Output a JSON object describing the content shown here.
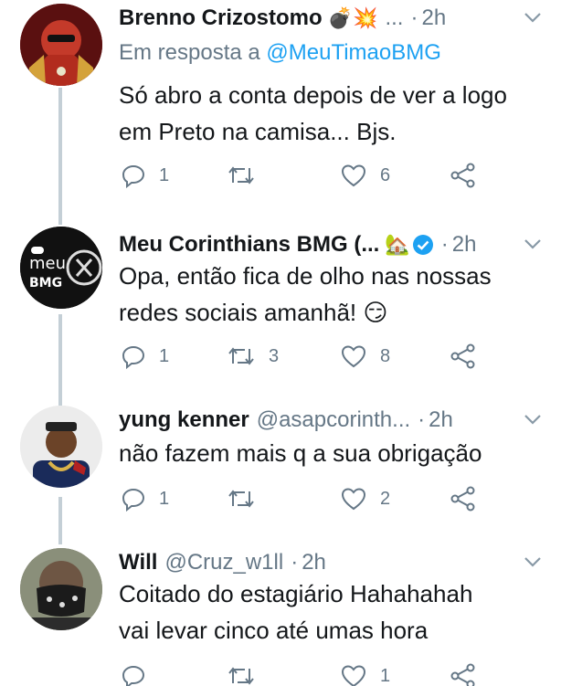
{
  "colors": {
    "secondary_text": "#657786",
    "link": "#1da1f2",
    "verified": "#1da1f2"
  },
  "tweets": [
    {
      "name": "Brenno Crizostomo",
      "name_emoji": "💣💥",
      "ellipsis": "...",
      "time": "2h",
      "reply_prefix": "Em resposta a",
      "reply_mention": "@MeuTimaoBMG",
      "text_line1": "Só abro a conta depois de ver a logo",
      "text_line2": "em Preto na camisa... Bjs.",
      "replies": "1",
      "retweets": "",
      "likes": "6"
    },
    {
      "name": "Meu Corinthians BMG (...",
      "name_emoji": "🏡",
      "time": "2h",
      "verified": true,
      "avatar_text_top": "meu",
      "avatar_text_bottom": "BMG",
      "text_line1": "Opa, então fica de olho nas nossas",
      "text_line2": "redes sociais amanhã! 😏",
      "replies": "1",
      "retweets": "3",
      "likes": "8"
    },
    {
      "name": "yung kenner",
      "handle": "@asapcorinth...",
      "time": "2h",
      "text_line1": "não fazem mais q a sua obrigação",
      "replies": "1",
      "retweets": "",
      "likes": "2"
    },
    {
      "name": "Will",
      "handle": "@Cruz_w1ll",
      "time": "2h",
      "text_line1": "Coitado do estagiário Hahahahah",
      "text_line2": "vai levar cinco até umas hora",
      "replies": "",
      "retweets": "",
      "likes": "1"
    }
  ]
}
